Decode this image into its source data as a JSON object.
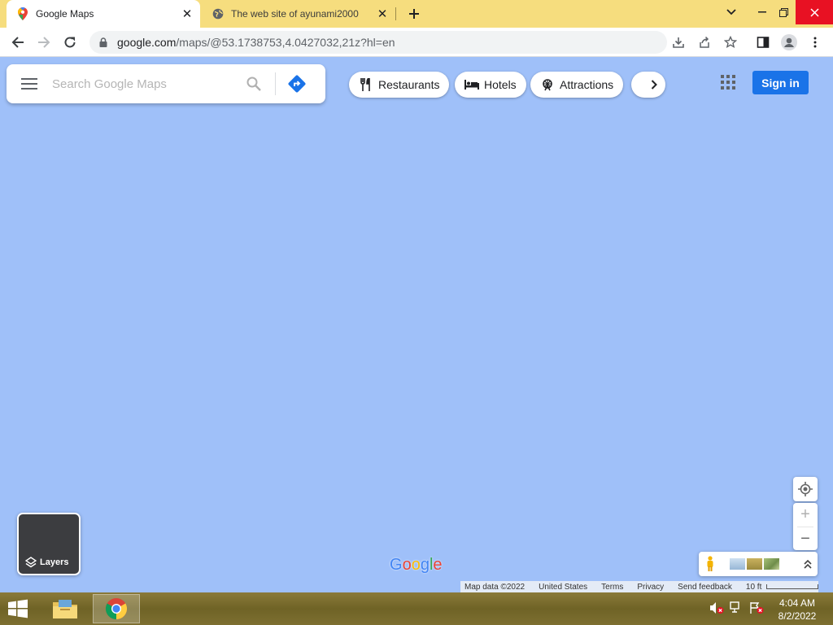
{
  "browser": {
    "tabs": [
      {
        "title": "Google Maps",
        "active": true,
        "icon": "google-maps-pin-icon"
      },
      {
        "title": "The web site of ayunami2000",
        "active": false,
        "icon": "globe-icon"
      }
    ],
    "new_tab_icon": "plus-icon",
    "address": {
      "host": "google.com",
      "path": "/maps/@53.1738753,4.0427032,21z?hl=en"
    },
    "accent": "#f6dd7e"
  },
  "maps": {
    "search": {
      "placeholder": "Search Google Maps"
    },
    "chips": [
      {
        "label": "Restaurants",
        "icon": "fork-knife-icon"
      },
      {
        "label": "Hotels",
        "icon": "bed-icon"
      },
      {
        "label": "Attractions",
        "icon": "ferris-wheel-icon"
      }
    ],
    "sign_in_label": "Sign in",
    "layers_label": "Layers",
    "logo_text": "Google",
    "footer": {
      "map_data": "Map data ©2022",
      "region": "United States",
      "terms": "Terms",
      "privacy": "Privacy",
      "feedback": "Send feedback",
      "scale": "10 ft"
    },
    "zoom": {
      "in": "+",
      "out": "−"
    },
    "water_color": "#9fc0f9",
    "button_color": "#1a73e8"
  },
  "taskbar": {
    "time": "4:04 AM",
    "date": "8/2/2022"
  }
}
